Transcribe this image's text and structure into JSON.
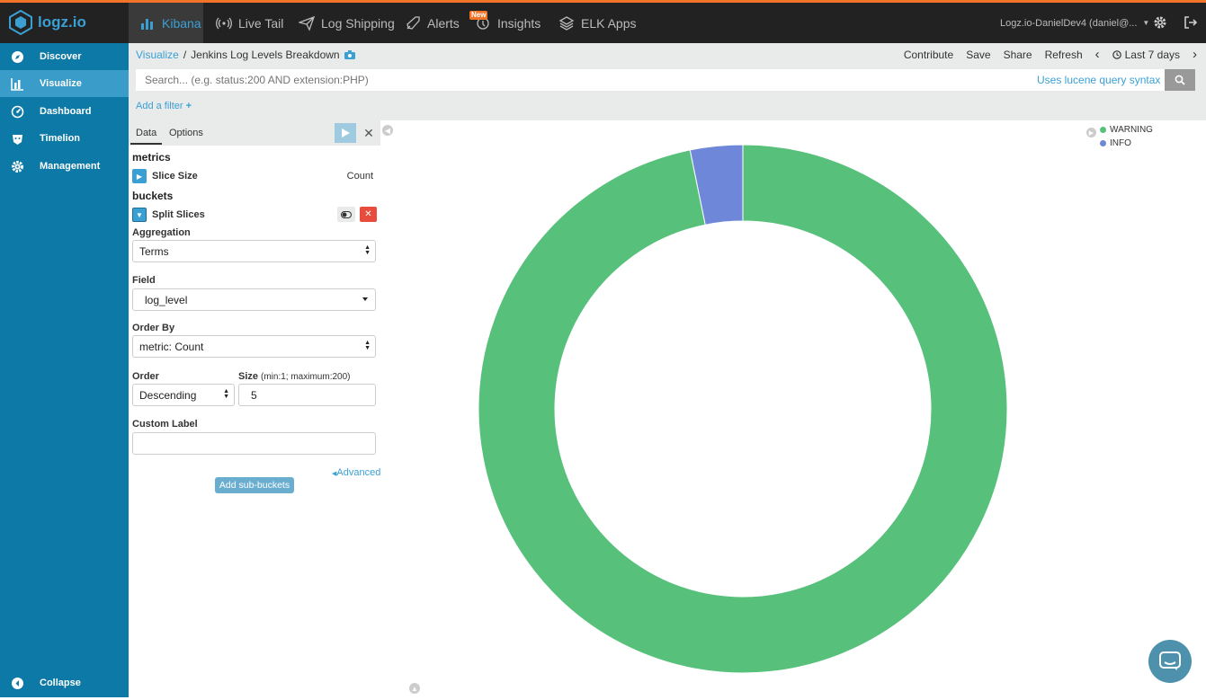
{
  "topnav": {
    "logo_text": "logz.io",
    "items": [
      {
        "label": "Kibana",
        "icon": "bar-chart-icon",
        "active": true
      },
      {
        "label": "Live Tail",
        "icon": "live-tail-icon"
      },
      {
        "label": "Log Shipping",
        "icon": "paper-plane-icon"
      },
      {
        "label": "Alerts",
        "icon": "rocket-icon"
      },
      {
        "label": "Insights",
        "icon": "insights-icon",
        "badge": "New"
      },
      {
        "label": "ELK Apps",
        "icon": "layers-icon"
      }
    ],
    "user_label": "Logz.io-DanielDev4 (daniel@..."
  },
  "sidebar": {
    "items": [
      {
        "label": "Discover",
        "icon": "compass-icon"
      },
      {
        "label": "Visualize",
        "icon": "bar-chart-icon",
        "active": true
      },
      {
        "label": "Dashboard",
        "icon": "dashboard-icon"
      },
      {
        "label": "Timelion",
        "icon": "timelion-icon"
      },
      {
        "label": "Management",
        "icon": "gear-icon"
      }
    ],
    "collapse_label": "Collapse"
  },
  "breadcrumb": {
    "root": "Visualize",
    "separator": "/",
    "current": "Jenkins Log Levels Breakdown"
  },
  "actions": {
    "contribute": "Contribute",
    "save": "Save",
    "share": "Share",
    "refresh": "Refresh",
    "time_range": "Last 7 days"
  },
  "search": {
    "placeholder": "Search... (e.g. status:200 AND extension:PHP)",
    "lucene_link": "Uses lucene query syntax"
  },
  "filter": {
    "add_label": "Add a filter"
  },
  "editor": {
    "tabs": {
      "data": "Data",
      "options": "Options"
    },
    "metrics_title": "metrics",
    "metric": {
      "name": "Slice Size",
      "value": "Count"
    },
    "buckets_title": "buckets",
    "bucket": {
      "name": "Split Slices"
    },
    "aggregation": {
      "label": "Aggregation",
      "value": "Terms"
    },
    "field": {
      "label": "Field",
      "value": "log_level"
    },
    "order_by": {
      "label": "Order By",
      "value": "metric: Count"
    },
    "order": {
      "label": "Order",
      "value": "Descending"
    },
    "size": {
      "label": "Size",
      "hint": "(min:1; maximum:200)",
      "value": "5"
    },
    "custom_label": {
      "label": "Custom Label",
      "value": ""
    },
    "advanced": "Advanced",
    "add_sub_buckets": "Add sub-buckets"
  },
  "chart_data": {
    "type": "pie",
    "donut": true,
    "labels": [
      "WARNING",
      "INFO"
    ],
    "values": [
      96.8,
      3.2
    ],
    "colors": [
      "#57c17b",
      "#6f87d8"
    ],
    "legend_position": "top-right"
  }
}
